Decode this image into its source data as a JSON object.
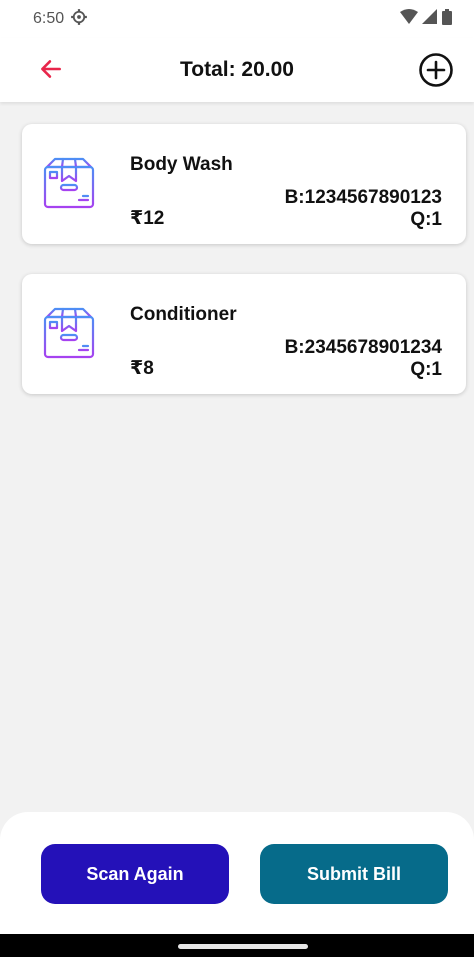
{
  "status_bar": {
    "time": "6:50"
  },
  "app_bar": {
    "title": "Total: 20.00"
  },
  "items": [
    {
      "name": "Body Wash",
      "barcode": "B:1234567890123",
      "price": "₹12",
      "quantity": "Q:1"
    },
    {
      "name": "Conditioner",
      "barcode": "B:2345678901234",
      "price": "₹8",
      "quantity": "Q:1"
    }
  ],
  "actions": {
    "scan_again": "Scan Again",
    "submit_bill": "Submit Bill"
  },
  "colors": {
    "accent_red": "#e8264b",
    "scan_button": "#2411b8",
    "submit_button": "#066b8a",
    "box_icon_gradient_start": "#4d8ff5",
    "box_icon_gradient_end": "#a642f0"
  },
  "icons": {
    "back": "arrow-left",
    "add": "plus-circle",
    "item": "package-box",
    "settings": "gear",
    "wifi": "wifi",
    "signal": "signal",
    "battery": "battery"
  }
}
